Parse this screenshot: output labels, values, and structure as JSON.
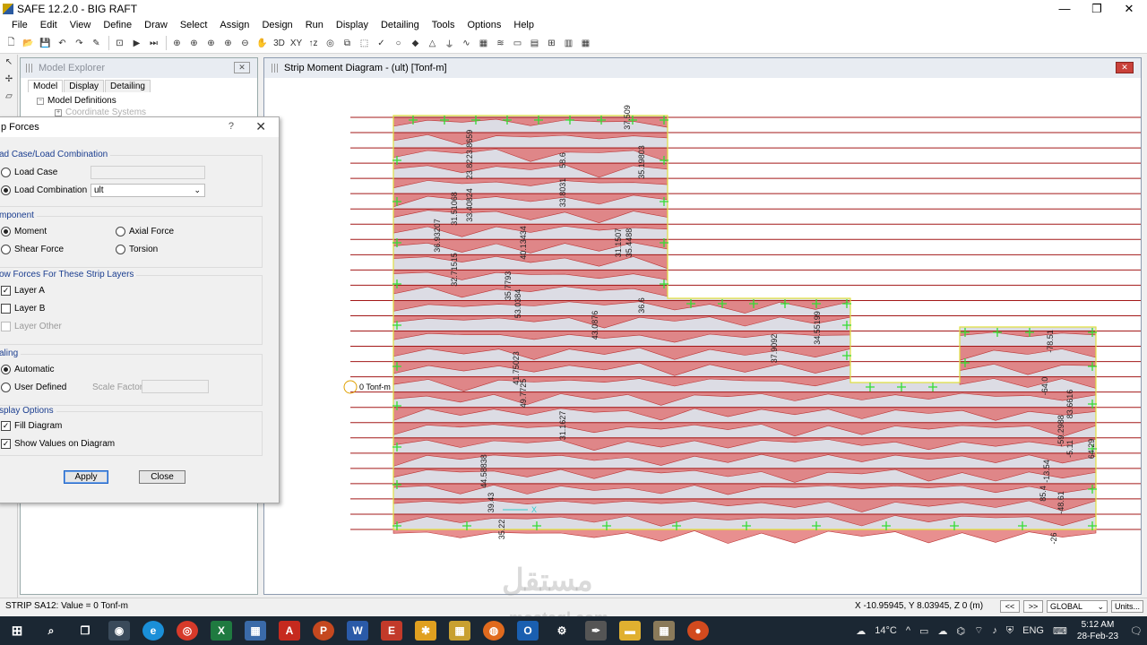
{
  "window": {
    "title": "SAFE 12.2.0 - BIG RAFT",
    "minimize": "—",
    "maximize": "❐",
    "close": "✕"
  },
  "menu": [
    "File",
    "Edit",
    "View",
    "Define",
    "Draw",
    "Select",
    "Assign",
    "Design",
    "Run",
    "Display",
    "Detailing",
    "Tools",
    "Options",
    "Help"
  ],
  "explorer": {
    "title": "Model Explorer",
    "close": "✕",
    "tabs": [
      "Model",
      "Display",
      "Detailing"
    ],
    "tree_root": "Model Definitions",
    "tree_child": "Coordinate Systems"
  },
  "dialog": {
    "title": "p Forces",
    "help": "?",
    "close": "✕",
    "group_load": "ad Case/Load Combination",
    "load_case": "Load Case",
    "load_combination": "Load Combination",
    "load_combination_value": "ult",
    "group_component": "mponent",
    "moment": "Moment",
    "axial_force": "Axial Force",
    "shear_force": "Shear Force",
    "torsion": "Torsion",
    "group_layers": "ow Forces For These Strip Layers",
    "layer_a": "Layer A",
    "layer_b": "Layer B",
    "layer_other": "Layer Other",
    "group_scaling": "aling",
    "automatic": "Automatic",
    "user_defined": "User Defined",
    "scale_factor": "Scale Factor",
    "group_display": "splay Options",
    "fill_diagram": "Fill Diagram",
    "show_values": "Show Values on Diagram",
    "apply": "Apply",
    "close_btn": "Close"
  },
  "drawing": {
    "title": "Strip Moment Diagram  -  (ult)  [Tonf-m]",
    "close": "✕",
    "origin_label": "0 Tonf-m",
    "axis_x": "X",
    "value_labels": [
      "23.8659",
      "23.82",
      "33.40824",
      "31.51068",
      "36.93207",
      "32.71515",
      "40.13434",
      "35.7793",
      "53.0384",
      "58.6",
      "33.8031",
      "37.509",
      "35.19803",
      "31.1507",
      "35.4488",
      "36.6",
      "43.0876",
      "34.55199",
      "37.9092",
      "41.75023",
      "49.7725",
      "31.1627",
      "44.58838",
      "35.22",
      "39.43",
      "-64.0",
      "-59.2988",
      "-5.11",
      "83.6616",
      "64.29",
      "-13.54",
      "-26",
      "-48.61",
      "85.4",
      "-78.51"
    ]
  },
  "status": {
    "left": "STRIP SA12:  Value = 0 Tonf-m",
    "coords": "X -10.95945,  Y 8.03945,  Z 0  (m)",
    "prev": "<<",
    "next": ">>",
    "coord_system": "GLOBAL",
    "units": "Units..."
  },
  "taskbar": {
    "weather": "14°C",
    "lang": "ENG",
    "time": "5:12 AM",
    "date": "28-Feb-23"
  },
  "watermark": {
    "arabic": "مستقل",
    "latin": "mostaql.com"
  },
  "colors": {
    "diagram_fill": "#e06a6a",
    "strip_line": "#a31818",
    "support_cross": "#33dd33",
    "slab_edge": "#e0e040"
  }
}
